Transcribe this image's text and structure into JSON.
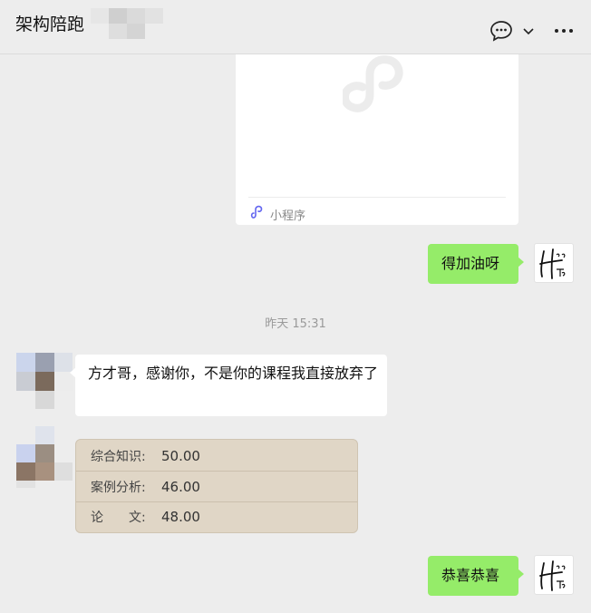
{
  "header": {
    "title": "架构陪跑",
    "icons": [
      "chat-bubble-icon",
      "chevron-down-icon",
      "more-icon"
    ]
  },
  "mini_program": {
    "label": "小程序",
    "icon": "mini-program-icon"
  },
  "messages": [
    {
      "side": "right",
      "text": "得加油呀"
    },
    {
      "side": "left",
      "text": "方才哥，感谢你，不是你的课程我直接放弃了"
    },
    {
      "side": "right",
      "text": "恭喜恭喜"
    }
  ],
  "timestamp": "昨天 15:31",
  "score_card": {
    "rows": [
      {
        "label": "综合知识:",
        "value": "50.00"
      },
      {
        "label": "案例分析:",
        "value": "46.00"
      },
      {
        "label": "论　　文:",
        "value": "48.00"
      }
    ]
  },
  "colors": {
    "background": "#ededed",
    "my_bubble": "#95ec69",
    "their_bubble": "#ffffff",
    "score_card": "#e0d6c6"
  }
}
